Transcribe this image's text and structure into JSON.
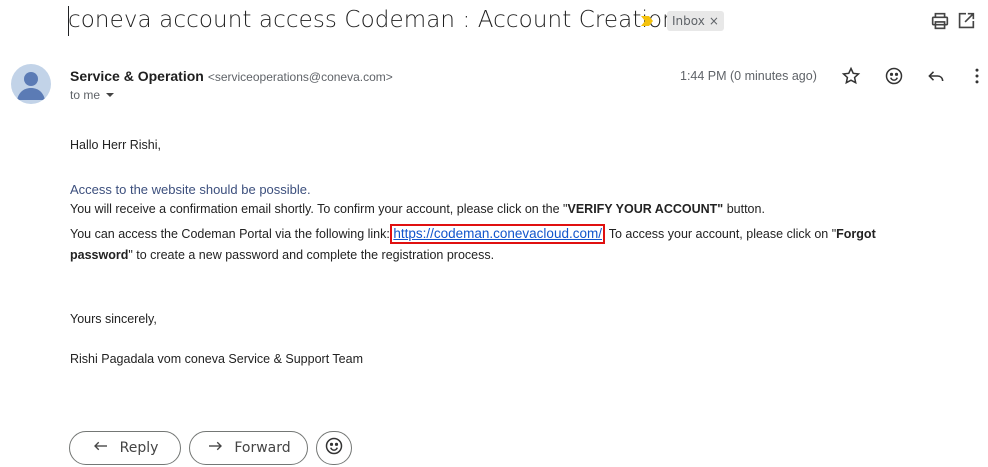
{
  "subject": {
    "title": "coneva account access Codeman : Account Creation",
    "label_chip": "Inbox",
    "label_chip_remove": "×"
  },
  "sender": {
    "name": "Service & Operation",
    "email": "<serviceoperations@coneva.com>",
    "to": "to me",
    "time": "1:44 PM (0 minutes ago)"
  },
  "body": {
    "greeting": "Hallo Herr Rishi,",
    "line1": "Access to the website should be possible.",
    "line2_pre": "You will receive a confirmation email shortly. To confirm your account, please click on the \"",
    "line2_bold": "VERIFY YOUR ACCOUNT\"",
    "line2_post": " button.",
    "line3_pre": "You can access the  Codeman Portal via the following link: ",
    "link": "https://codeman.conevacloud.com/",
    "line3_post": ". To access your account, please click on \"",
    "line3_bold": "Forgot",
    "line4_bold": "password",
    "line4_post": "\" to create a new password and complete the registration process.",
    "closing": "Yours sincerely,",
    "signature": "Rishi Pagadala vom coneva Service & Support Team"
  },
  "actions": {
    "reply": "Reply",
    "forward": "Forward"
  },
  "icons": {
    "print": "print-icon",
    "popout": "open-in-new-icon",
    "star": "star-icon",
    "emoji": "emoji-icon",
    "reply": "reply-icon",
    "more": "more-vert-icon",
    "importance": "importance-marker-icon"
  },
  "colors": {
    "importance": "#f4c20d",
    "highlight_box": "#e01010",
    "link": "#1155cc",
    "avatar_bg": "#c2d3e8"
  }
}
